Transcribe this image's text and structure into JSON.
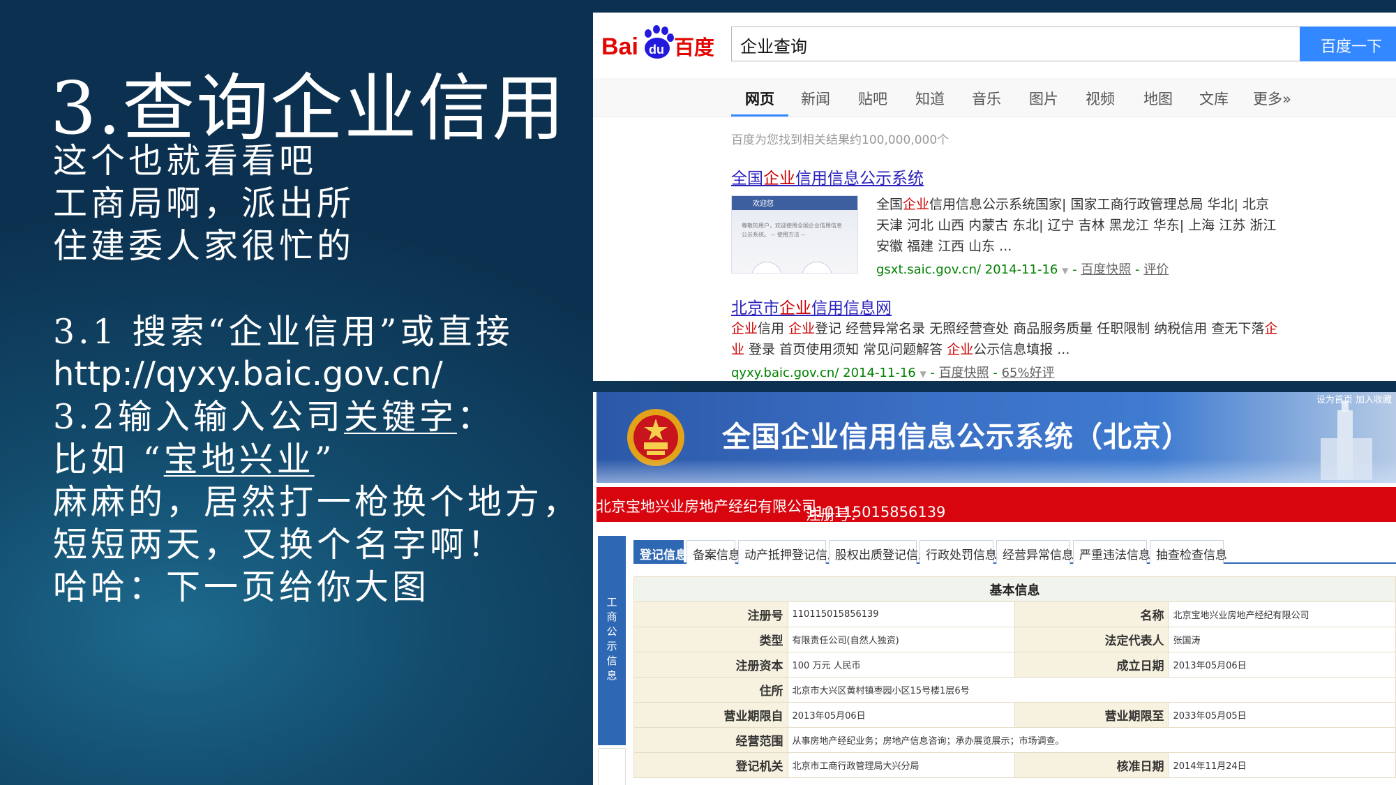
{
  "slide": {
    "title": "3.查询企业信用",
    "lines": [
      "这个也就看看吧",
      "工商局啊，派出所",
      "住建委人家很忙的"
    ],
    "line_31": "3.1 搜索“企业信用”或直接",
    "url": "http://qyxy.baic.gov.cn/",
    "line_32_prefix": "3.2输入输入公司",
    "line_32_keyword": "关键字",
    "line_32_suffix": "：",
    "example_prefix": "比如 “",
    "example_keyword": "宝地兴业",
    "example_suffix": "”",
    "line_a": "麻麻的，居然打一枪换个地方，",
    "line_b": "短短两天，又换个名字啊！",
    "line_c": "哈哈：下一页给你大图"
  },
  "baidu": {
    "logo_text_a": "Bai",
    "logo_text_du": "du",
    "logo_text_cn": "百度",
    "search_value": "企业查询",
    "search_button": "百度一下",
    "tabs": [
      "网页",
      "新闻",
      "贴吧",
      "知道",
      "音乐",
      "图片",
      "视频",
      "地图",
      "文库",
      "更多»"
    ],
    "result_count": "百度为您找到相关结果约100,000,000个",
    "result1": {
      "title_a": "全国",
      "title_hl": "企业",
      "title_b": "信用信息公示系统",
      "thumb_title": "欢迎您",
      "thumb_text": "尊敬的用户，欢迎使用全国企业信用信息公示系统。 -- 使用方法 --",
      "line1_a": "全国",
      "line1_hl": "企业",
      "line1_b": "信用信息公示系统国家| 国家工商行政管理总局 华北| 北京",
      "line2": "天津 河北 山西 内蒙古 东北| 辽宁 吉林 黑龙江 华东| 上海 江苏 浙江",
      "line3": "安徽 福建 江西 山东 ...",
      "url": "gsxt.saic.gov.cn/ 2014-11-16",
      "tri": "▼",
      "sep": " - ",
      "cache": "百度快照",
      "review": "评价"
    },
    "result2": {
      "title_a": "北京市",
      "title_hl": "企业",
      "title_b": "信用信息网",
      "line1_hl1": "企业",
      "line1_a": "信用 ",
      "line1_hl2": "企业",
      "line1_b": "登记 经营异常名录 无照经营查处 商品服务质量 任职限制 纳税信用 查无下落",
      "line1_hl3": "企",
      "line2_hl1": "业",
      "line2_a": " 登录 首页使用须知 常见问题解答 ",
      "line2_hl2": "企业",
      "line2_b": "公示信息填报 ...",
      "url": "qyxy.baic.gov.cn/ 2014-11-16",
      "tri": "▼",
      "sep": " - ",
      "cache": "百度快照",
      "review": "65%好评"
    }
  },
  "gsxt": {
    "banner_title": "全国企业信用信息公示系统（北京）",
    "top_links": "设为首页  加入收藏",
    "company_name": "北京宝地兴业房地产经纪有限公司",
    "reg_no_label": "注册号：",
    "reg_no": "110115015856139",
    "side_label": [
      "工",
      "商",
      "公",
      "示",
      "信",
      "息"
    ],
    "tabs": [
      "登记信息",
      "备案信息",
      "动产抵押登记信息",
      "股权出质登记信息",
      "行政处罚信息",
      "经营异常信息",
      "严重违法信息",
      "抽查检查信息"
    ],
    "table_header": "基本信息",
    "rows": [
      {
        "l1": "注册号",
        "v1": "110115015856139",
        "l2": "名称",
        "v2": "北京宝地兴业房地产经纪有限公司"
      },
      {
        "l1": "类型",
        "v1": "有限责任公司(自然人独资)",
        "l2": "法定代表人",
        "v2": "张国涛"
      },
      {
        "l1": "注册资本",
        "v1": "100 万元 人民币",
        "l2": "成立日期",
        "v2": "2013年05月06日"
      },
      {
        "l1": "住所",
        "v1": "北京市大兴区黄村镇枣园小区15号楼1层6号"
      },
      {
        "l1": "营业期限自",
        "v1": "2013年05月06日",
        "l2": "营业期限至",
        "v2": "2033年05月05日"
      },
      {
        "l1": "经营范围",
        "v1": "从事房地产经纪业务；房地产信息咨询；承办展览展示；市场调查。"
      },
      {
        "l1": "登记机关",
        "v1": "北京市工商行政管理局大兴分局",
        "l2": "核准日期",
        "v2": "2014年11月24日"
      }
    ]
  },
  "colors": {
    "slide_bg": "#124a6b",
    "baidu_blue": "#3388ff",
    "baidu_red": "#e10602",
    "link_blue": "#2a22bd",
    "highlight_red": "#cc0000",
    "url_green": "#008000",
    "gsxt_red": "#d8050f",
    "gsxt_blue": "#2e67b4"
  }
}
